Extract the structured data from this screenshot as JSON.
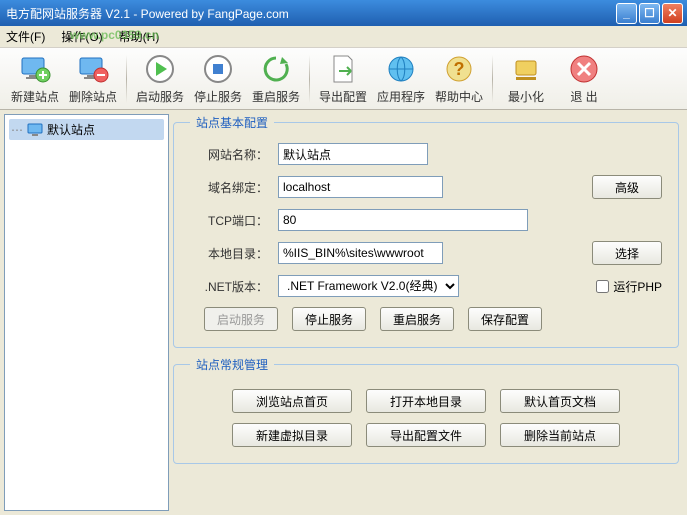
{
  "window": {
    "title": "电方配网站服务器 V2.1 - Powered by FangPage.com"
  },
  "menu": {
    "file": "文件(F)",
    "operate": "操作(O)",
    "help": "帮助(H)"
  },
  "watermark": "www.pc0359.cn",
  "toolbar": {
    "new_site": "新建站点",
    "delete_site": "删除站点",
    "start_service": "启动服务",
    "stop_service": "停止服务",
    "restart_service": "重启服务",
    "export_config": "导出配置",
    "application": "应用程序",
    "help_center": "帮助中心",
    "minimize": "最小化",
    "exit": "退 出"
  },
  "sidebar": {
    "default_site": "默认站点"
  },
  "basic_config": {
    "legend": "站点基本配置",
    "site_name_label": "网站名称：",
    "site_name_value": "默认站点",
    "domain_label": "域名绑定：",
    "domain_value": "localhost",
    "advanced": "高级",
    "port_label": "TCP端口：",
    "port_value": "80",
    "local_dir_label": "本地目录：",
    "local_dir_value": "%IIS_BIN%\\sites\\wwwroot",
    "select": "选择",
    "net_version_label": ".NET版本：",
    "net_version_value": ".NET Framework V2.0(经典)",
    "run_php": "运行PHP",
    "start_service_btn": "启动服务",
    "stop_service_btn": "停止服务",
    "restart_service_btn": "重启服务",
    "save_config_btn": "保存配置"
  },
  "regular_mgmt": {
    "legend": "站点常规管理",
    "browse_home": "浏览站点首页",
    "open_local_dir": "打开本地目录",
    "default_home_doc": "默认首页文档",
    "new_virtual_dir": "新建虚拟目录",
    "export_config_file": "导出配置文件",
    "delete_current_site": "删除当前站点"
  }
}
